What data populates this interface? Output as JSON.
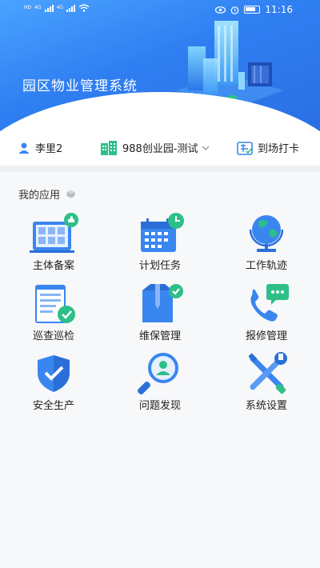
{
  "status_bar": {
    "time": "11:16",
    "sim1": "HD",
    "sim2": "HD",
    "net1": "4G",
    "net2": "4G"
  },
  "header": {
    "title": "园区物业管理系统"
  },
  "info_bar": {
    "user_name": "李里2",
    "park_name": "988创业园-测试",
    "check_in_label": "到场打卡"
  },
  "apps_section": {
    "title": "我的应用",
    "apps": [
      {
        "label": "主体备案",
        "icon": "building-grid-icon"
      },
      {
        "label": "计划任务",
        "icon": "calendar-clock-icon"
      },
      {
        "label": "工作轨迹",
        "icon": "globe-icon"
      },
      {
        "label": "巡查巡检",
        "icon": "checklist-icon"
      },
      {
        "label": "维保管理",
        "icon": "maintenance-box-icon"
      },
      {
        "label": "报修管理",
        "icon": "phone-chat-icon"
      },
      {
        "label": "安全生产",
        "icon": "shield-check-icon"
      },
      {
        "label": "问题发现",
        "icon": "magnifier-person-icon"
      },
      {
        "label": "系统设置",
        "icon": "tools-icon"
      }
    ]
  },
  "colors": {
    "primary": "#2f7ff2",
    "accent_green": "#2dbf87",
    "icon_blue": "#3a86f0"
  }
}
